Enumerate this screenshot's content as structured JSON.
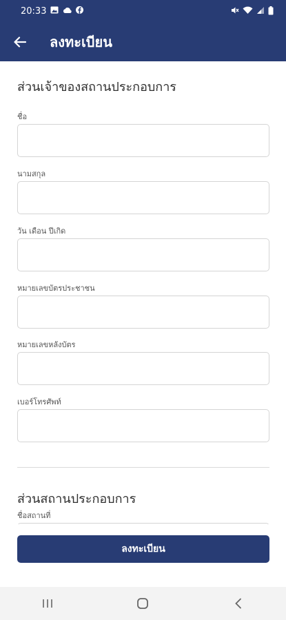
{
  "status": {
    "time": "20:33"
  },
  "appbar": {
    "title": "ลงทะเบียน"
  },
  "owner_section": {
    "title": "ส่วนเจ้าของสถานประกอบการ",
    "fields": [
      {
        "label": "ชื่อ",
        "value": ""
      },
      {
        "label": "นามสกุล",
        "value": ""
      },
      {
        "label": "วัน เดือน ปีเกิด",
        "value": ""
      },
      {
        "label": "หมายเลขบัตรประชาชน",
        "value": ""
      },
      {
        "label": "หมายเลขหลังบัตร",
        "value": ""
      },
      {
        "label": "เบอร์โทรศัพท์",
        "value": ""
      }
    ]
  },
  "business_section": {
    "title": "ส่วนสถานประกอบการ",
    "fields": [
      {
        "label": "ชื่อสถานที่",
        "value": ""
      }
    ]
  },
  "submit_label": "ลงทะเบียน",
  "colors": {
    "primary": "#283c74",
    "input_border": "#d4d4d4",
    "navbar_bg": "#f3f3f3"
  },
  "icons": [
    "image-icon",
    "cloud-icon",
    "facebook-icon",
    "mute-icon",
    "wifi-icon",
    "signal-icon",
    "battery-icon",
    "back-arrow-icon",
    "recent-apps-icon",
    "home-icon",
    "nav-back-icon"
  ]
}
